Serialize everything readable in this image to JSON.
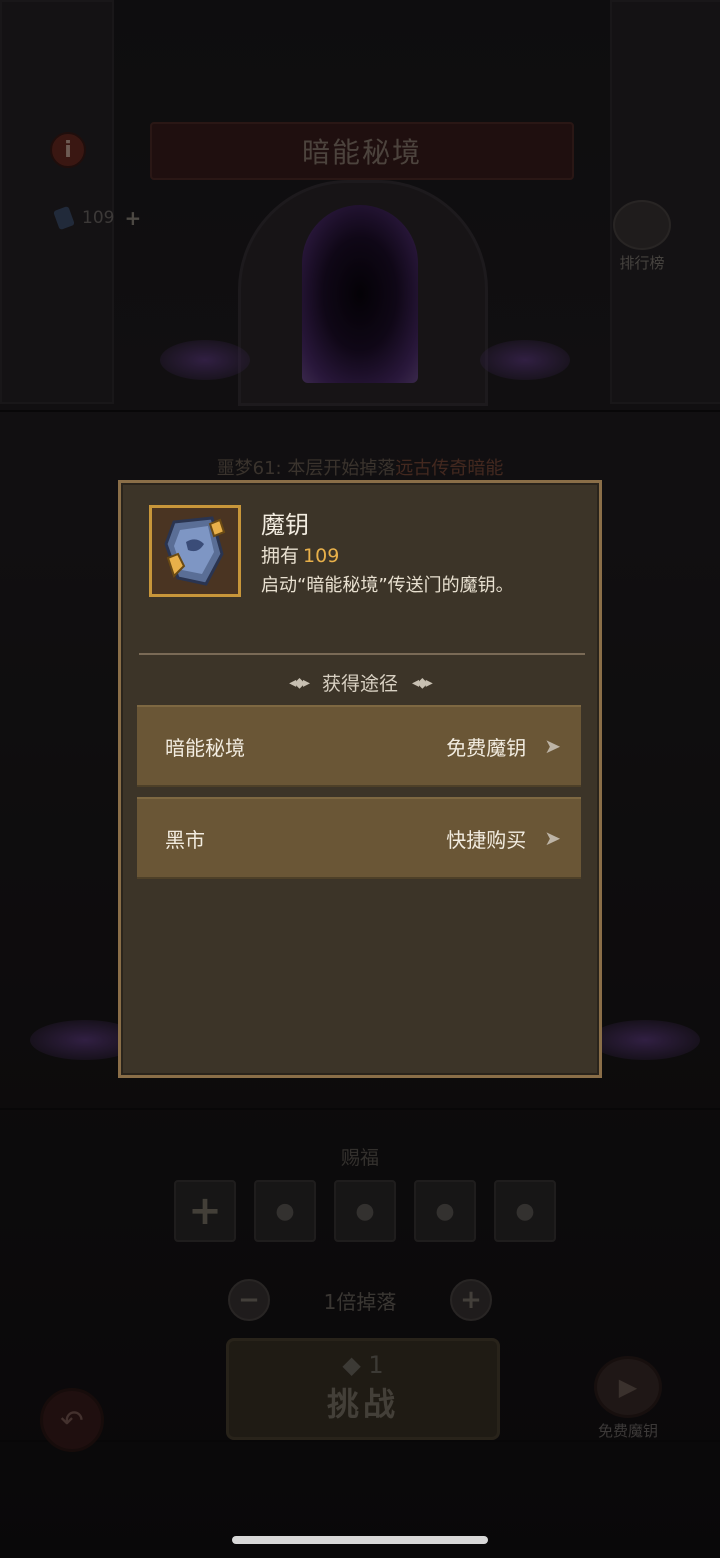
{
  "background": {
    "title": "暗能秘境",
    "info_label": "i",
    "key_count": "109",
    "rank_label": "排行榜",
    "floor_note_prefix": "噩梦61: 本层开始掉落",
    "floor_note_highlight": "远古传奇暗能",
    "bless_title": "赐福",
    "multiplier_label": "1倍掉落",
    "challenge_cost": "1",
    "challenge_label": "挑战",
    "free_key_label": "免费魔钥"
  },
  "dialog": {
    "item_name": "魔钥",
    "own_label": "拥有",
    "own_count": "109",
    "description": "启动“暗能秘境”传送门的魔钥。",
    "sources_title": "获得途径",
    "sources": [
      {
        "name": "暗能秘境",
        "action": "免费魔钥"
      },
      {
        "name": "黑市",
        "action": "快捷购买"
      }
    ]
  },
  "colors": {
    "dialog_bg": "#3c3428",
    "dialog_border": "#8a6e48",
    "row_bg": "#6a5636",
    "count_highlight": "#e8b04a",
    "icon_frame": "#c8963a"
  },
  "icons": [
    "info-icon",
    "key-icon",
    "rank-icon",
    "plus-icon",
    "lock-icon",
    "minus-icon",
    "back-icon",
    "play-icon",
    "chevron-right-icon",
    "magic-key-icon"
  ]
}
